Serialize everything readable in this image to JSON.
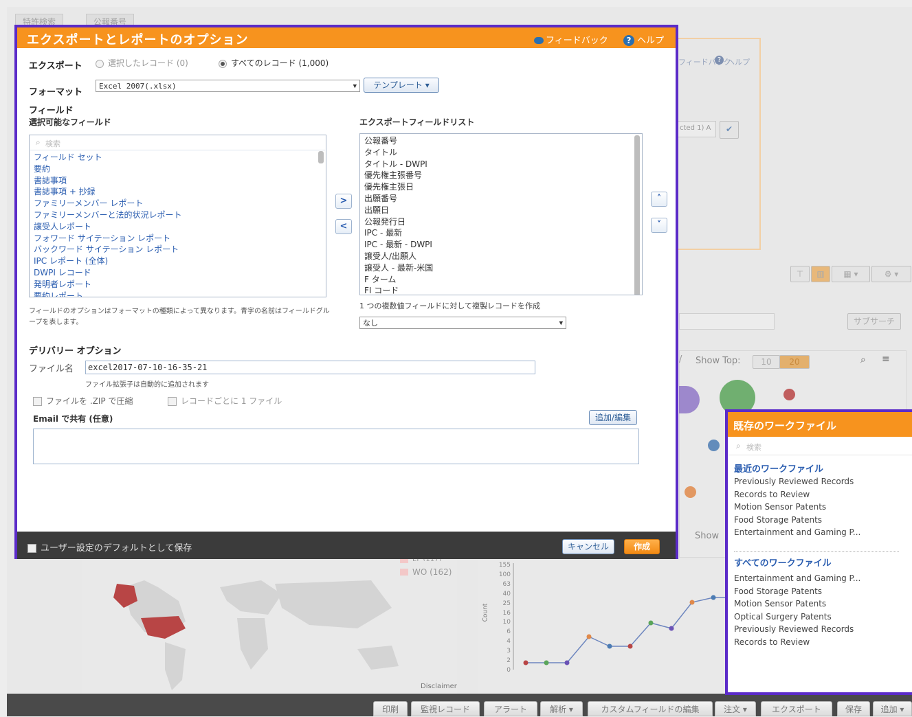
{
  "background": {
    "tabs": [
      "特許検索",
      "公報番号"
    ],
    "feedback_link": "フィードバック",
    "help_link": "ヘルプ",
    "selected_label": "cted 1) A",
    "subquery_button": "サブサーチ",
    "show_top_label": "Show Top:",
    "show_top_options": [
      "10",
      "20"
    ],
    "show_label": "Show",
    "map_legend_partial": "EP (117)",
    "map_legend": "WO (162)",
    "disclaimer": "Disclaimer",
    "line_chart_ylabel": "Count",
    "line_chart_ticks": [
      "155",
      "100",
      "63",
      "40",
      "25",
      "16",
      "10",
      "6",
      "4",
      "3",
      "2",
      "0"
    ]
  },
  "bottom_toolbar": {
    "buttons": [
      "印刷",
      "監視レコード",
      "アラート",
      "解析",
      "カスタムフィールドの編集",
      "注文",
      "エクスポート",
      "保存",
      "追加"
    ]
  },
  "dialog": {
    "title": "エクスポートとレポートのオプション",
    "feedback": "フィードバック",
    "help": "ヘルプ",
    "export_label": "エクスポート",
    "radio_selected": "選択したレコード (0)",
    "radio_all": "すべてのレコード (1,000)",
    "format_label": "フォーマット",
    "format_value": "Excel 2007(.xlsx)",
    "template_button": "テンプレート",
    "fields_label": "フィールド",
    "available_fields_label": "選択可能なフィールド",
    "search_placeholder": "検索",
    "available_fields": [
      "フィールド セット",
      "要約",
      "書誌事項",
      "書誌事項 + 抄録",
      "ファミリーメンバー レポート",
      "ファミリーメンバーと法的状況レポート",
      "譲受人レポート",
      "フォワード サイテーション レポート",
      "バックワード サイテーション レポート",
      "IPC レポート (全体)",
      "DWPI レコード",
      "発明者レポート",
      "要約レポート"
    ],
    "export_list_label": "エクスポートフィールドリスト",
    "export_fields": [
      "公報番号",
      "タイトル",
      "タイトル - DWPI",
      "優先権主張番号",
      "優先権主張日",
      "出願番号",
      "出願日",
      "公報発行日",
      "IPC - 最新",
      "IPC - 最新 - DWPI",
      "譲受人/出願人",
      "譲受人 - 最新-米国",
      "F ターム",
      "FI コード"
    ],
    "fields_note": "フィールドのオプションはフォーマットの種類によって異なります。青字の名前はフィールドグループを表します。",
    "duplicate_label": "1 つの複数値フィールドに対して複製レコードを作成",
    "duplicate_value": "なし",
    "delivery_label": "デリバリー オプション",
    "filename_label": "ファイル名",
    "filename_value": "excel2017-07-10-16-35-21",
    "ext_note": "ファイル拡張子は自動的に追加されます",
    "zip_checkbox": "ファイルを .ZIP で圧縮",
    "per_record_checkbox": "レコードごとに 1 ファイル",
    "email_label": "Email で共有 (任意)",
    "add_edit_button": "追加/編集",
    "save_default": "ユーザー設定のデフォルトとして保存",
    "cancel_button": "キャンセル",
    "create_button": "作成"
  },
  "workfile_panel": {
    "title": "既存のワークファイル",
    "search_placeholder": "検索",
    "recent_heading": "最近のワークファイル",
    "recent_items": [
      "Previously Reviewed Records",
      "Records to Review",
      "Motion Sensor Patents",
      "Food Storage Patents",
      "Entertainment and Gaming P..."
    ],
    "all_heading": "すべてのワークファイル",
    "all_items": [
      "Entertainment and Gaming P...",
      "Food Storage Patents",
      "Motion Sensor Patents",
      "Optical Surgery Patents",
      "Previously Reviewed Records",
      "Records to Review"
    ]
  },
  "colors": {
    "accent_orange": "#f7931e",
    "highlight_purple": "#5b2bc8",
    "link_blue": "#2a5db0"
  }
}
